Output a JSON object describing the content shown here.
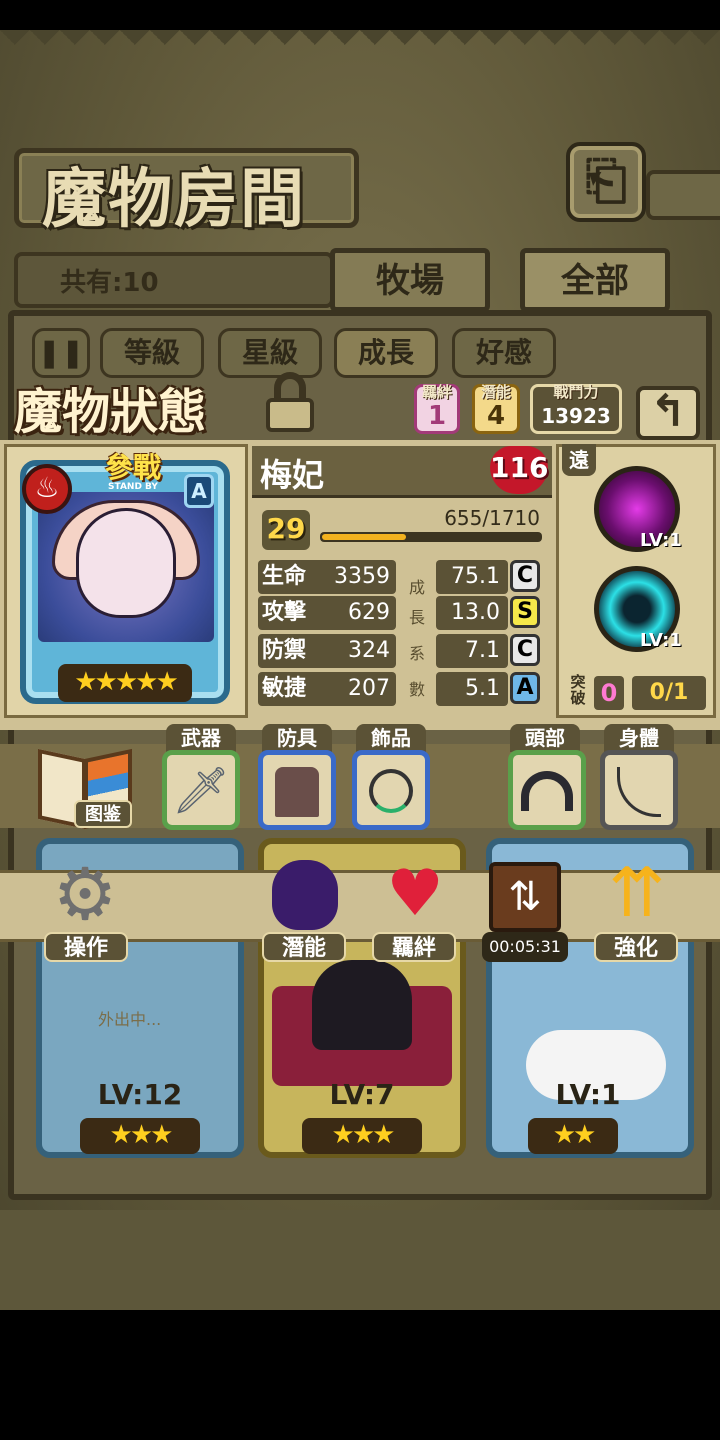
{
  "header": {
    "title": "魔物房間",
    "back_icon": "return-icon"
  },
  "room": {
    "count_label": "共有:10",
    "tabs": [
      "牧場",
      "全部"
    ],
    "active_tab": "全部"
  },
  "sort": {
    "pause_icon": "pause-icon",
    "options": [
      "等級",
      "星級",
      "成長",
      "好感"
    ]
  },
  "status": {
    "title": "魔物狀態",
    "lock_icon": "lock-icon",
    "bond_label": "羈絆",
    "bond_value": "1",
    "potential_label": "潛能",
    "potential_value": "4",
    "power_label": "戰鬥力",
    "power_value": "13923",
    "back_icon": "back-arrow-icon"
  },
  "card": {
    "stand_main": "參戰",
    "stand_sub": "STAND BY",
    "element_icon": "fire-icon",
    "rank": "A",
    "stars": "★★★★★",
    "star_count": 5
  },
  "monster": {
    "name": "梅妃",
    "affection": "116",
    "level": "29",
    "xp": "655/1710",
    "xp_current": 655,
    "xp_max": 1710
  },
  "stats": [
    {
      "name": "生命",
      "value": "3359",
      "growth": "75.1",
      "grade": "C"
    },
    {
      "name": "攻擊",
      "value": "629",
      "growth": "13.0",
      "grade": "S"
    },
    {
      "name": "防禦",
      "value": "324",
      "growth": "7.1",
      "grade": "C"
    },
    {
      "name": "敏捷",
      "value": "207",
      "growth": "5.1",
      "grade": "A"
    }
  ],
  "growth_label_chars": [
    "成",
    "長",
    "系",
    "數"
  ],
  "skills": {
    "range": "遠",
    "items": [
      {
        "level": "LV:1",
        "icon": "dark-orb-icon"
      },
      {
        "level": "LV:1",
        "icon": "cyan-swirl-icon"
      }
    ],
    "break_label": "突破",
    "break_count": "0",
    "break_fraction": "0/1"
  },
  "equipment": {
    "book_label": "图鉴",
    "slots": [
      {
        "label": "武器",
        "icon": "sword-icon"
      },
      {
        "label": "防具",
        "icon": "jacket-icon"
      },
      {
        "label": "飾品",
        "icon": "necklace-icon"
      },
      {
        "label": "頭部",
        "icon": "headband-icon"
      },
      {
        "label": "身體",
        "icon": "whip-icon"
      }
    ]
  },
  "actions": [
    {
      "label": "操作",
      "icon": "gear-icon"
    },
    {
      "label": "潛能",
      "icon": "demon-icon"
    },
    {
      "label": "羈絆",
      "icon": "hearts-icon"
    },
    {
      "label": "",
      "icon": "swap-box-icon",
      "timer": "00:05:31"
    },
    {
      "label": "強化",
      "icon": "up-arrows-icon"
    }
  ],
  "monster_list": [
    {
      "level": "LV:12",
      "stars": "★★★",
      "status": "外出中..."
    },
    {
      "level": "LV:7",
      "stars": "★★★",
      "status": ""
    },
    {
      "level": "LV:1",
      "stars": "★★",
      "status": ""
    }
  ],
  "colors": {
    "panel": "#cfc195",
    "frame": "#3a3320",
    "accent_gold": "#ffd84a",
    "grade_S": "#f5e84a",
    "grade_C": "#e8e8e8",
    "grade_A": "#6fb7e8"
  }
}
